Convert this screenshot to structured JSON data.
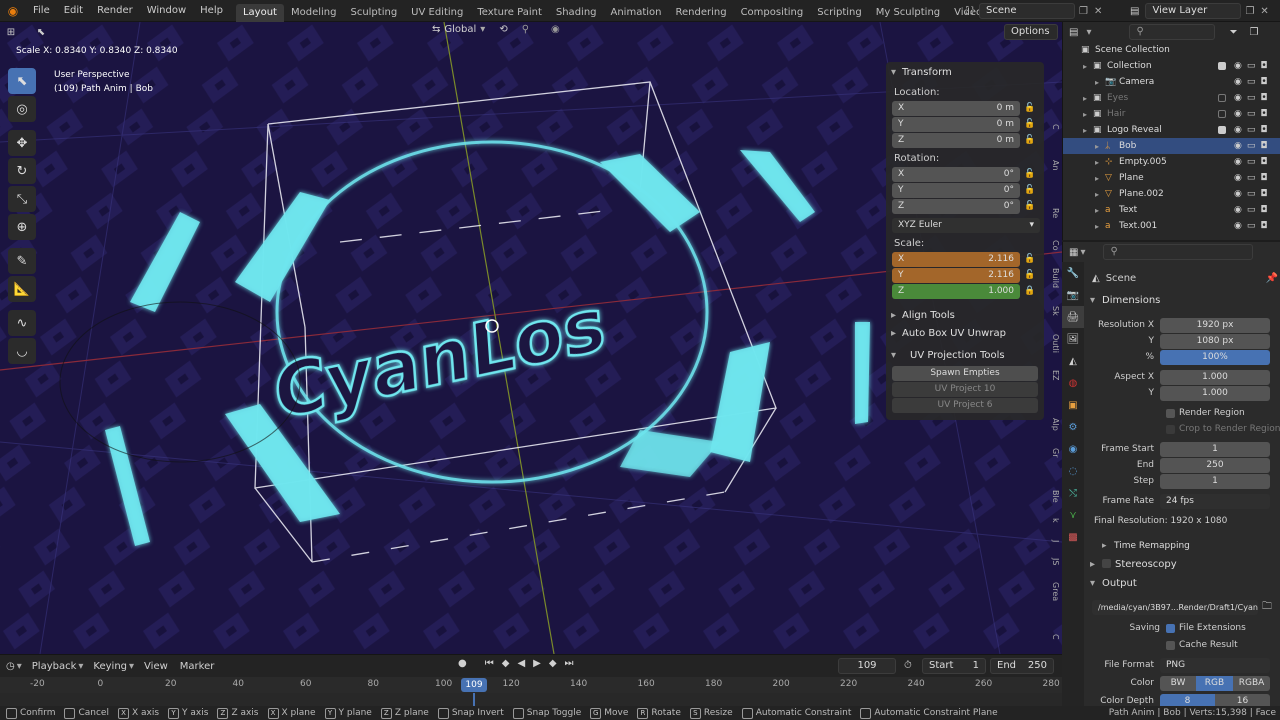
{
  "topbar": {
    "menus": [
      "File",
      "Edit",
      "Render",
      "Window",
      "Help"
    ],
    "workspaces": [
      "Layout",
      "Modeling",
      "Sculpting",
      "UV Editing",
      "Texture Paint",
      "Shading",
      "Animation",
      "Rendering",
      "Compositing",
      "Scripting",
      "My Sculpting",
      "Video Editing"
    ],
    "active_workspace": "Layout",
    "scene": "Scene",
    "view_layer": "View Layer"
  },
  "viewport": {
    "scale_readout": "Scale X: 0.8340   Y: 0.8340   Z: 0.8340",
    "orientation": "Global",
    "options_label": "Options",
    "view_name": "User Perspective",
    "object_info": "(109) Path Anim | Bob",
    "logo_text": "CyanLos"
  },
  "npanel": {
    "transform_title": "Transform",
    "location_label": "Location:",
    "location": [
      {
        "axis": "X",
        "value": "0 m"
      },
      {
        "axis": "Y",
        "value": "0 m"
      },
      {
        "axis": "Z",
        "value": "0 m"
      }
    ],
    "rotation_label": "Rotation:",
    "rotation": [
      {
        "axis": "X",
        "value": "0°"
      },
      {
        "axis": "Y",
        "value": "0°"
      },
      {
        "axis": "Z",
        "value": "0°"
      }
    ],
    "rotation_mode": "XYZ Euler",
    "scale_label": "Scale:",
    "scale": [
      {
        "axis": "X",
        "value": "2.116"
      },
      {
        "axis": "Y",
        "value": "2.116"
      },
      {
        "axis": "Z",
        "value": "1.000"
      }
    ],
    "align_tools": "Align Tools",
    "auto_box_uv": "Auto Box UV Unwrap",
    "uv_projection_tools": "UV Projection Tools",
    "spawn_empties": "Spawn Empties",
    "uv_project_10": "UV Project 10",
    "uv_project_6": "UV Project 6",
    "tabs": [
      "C",
      "An",
      "Re",
      "Co",
      "Build",
      "Sk",
      "Outli",
      "EZ",
      "Alp",
      "Gr",
      "Ble",
      "k",
      "J",
      "JS",
      "Grea",
      "C"
    ]
  },
  "outliner": {
    "rows": [
      {
        "label": "Scene Collection",
        "indent": 0,
        "sel": false,
        "dim": false,
        "check": null
      },
      {
        "label": "Collection",
        "indent": 1,
        "sel": false,
        "dim": false,
        "check": "on"
      },
      {
        "label": "Camera",
        "indent": 2,
        "sel": false,
        "dim": false,
        "check": null
      },
      {
        "label": "Eyes",
        "indent": 1,
        "sel": false,
        "dim": true,
        "check": "off"
      },
      {
        "label": "Hair",
        "indent": 1,
        "sel": false,
        "dim": true,
        "check": "off"
      },
      {
        "label": "Logo Reveal",
        "indent": 1,
        "sel": false,
        "dim": false,
        "check": "on"
      },
      {
        "label": "Bob",
        "indent": 2,
        "sel": true,
        "dim": false,
        "check": null
      },
      {
        "label": "Empty.005",
        "indent": 2,
        "sel": false,
        "dim": false,
        "check": null
      },
      {
        "label": "Plane",
        "indent": 2,
        "sel": false,
        "dim": false,
        "check": null
      },
      {
        "label": "Plane.002",
        "indent": 2,
        "sel": false,
        "dim": false,
        "check": null
      },
      {
        "label": "Text",
        "indent": 2,
        "sel": false,
        "dim": false,
        "check": null
      },
      {
        "label": "Text.001",
        "indent": 2,
        "sel": false,
        "dim": false,
        "check": null
      }
    ]
  },
  "properties": {
    "context": "Scene",
    "dimensions": "Dimensions",
    "res_x_label": "Resolution X",
    "res_x": "1920 px",
    "res_y_label": "Y",
    "res_y": "1080 px",
    "res_pct_label": "%",
    "res_pct": "100%",
    "aspect_x_label": "Aspect X",
    "aspect_x": "1.000",
    "aspect_y_label": "Y",
    "aspect_y": "1.000",
    "render_region": "Render Region",
    "crop_region": "Crop to Render Region",
    "frame_start_label": "Frame Start",
    "frame_start": "1",
    "frame_end_label": "End",
    "frame_end": "250",
    "frame_step_label": "Step",
    "frame_step": "1",
    "frame_rate_label": "Frame Rate",
    "frame_rate": "24 fps",
    "final_res": "Final Resolution: 1920 x 1080",
    "time_remapping": "Time Remapping",
    "stereoscopy": "Stereoscopy",
    "output": "Output",
    "output_path": "/media/cyan/3B97...Render/Draft1/Cyan",
    "saving_label": "Saving",
    "file_extensions": "File Extensions",
    "cache_result": "Cache Result",
    "file_format_label": "File Format",
    "file_format": "PNG",
    "color_label": "Color",
    "color_bw": "BW",
    "color_rgb": "RGB",
    "color_rgba": "RGBA",
    "color_depth_label": "Color Depth",
    "depth_8": "8",
    "depth_16": "16"
  },
  "timeline": {
    "playback": "Playback",
    "keying": "Keying",
    "view": "View",
    "marker": "Marker",
    "current_frame": "109",
    "start_label": "Start",
    "start": "1",
    "end_label": "End",
    "end": "250",
    "ruler": [
      "-20",
      "0",
      "20",
      "40",
      "60",
      "80",
      "100",
      "120",
      "140",
      "160",
      "180",
      "200",
      "220",
      "240",
      "260",
      "280"
    ]
  },
  "statusbar": {
    "items": [
      "Confirm",
      "Cancel",
      "X axis",
      "Y axis",
      "Z axis",
      "X plane",
      "Y plane",
      "Z plane",
      "Snap Invert",
      "Snap Toggle",
      "Move",
      "Rotate",
      "Resize",
      "Automatic Constraint",
      "Automatic Constraint Plane"
    ],
    "keys": [
      "",
      "",
      "X",
      "Y",
      "Z",
      "X",
      "Y",
      "Z",
      "",
      "",
      "G",
      "R",
      "S",
      "",
      ""
    ],
    "info": "Path Anim | Bob | Verts:15,398 | Face"
  },
  "colors": {
    "accent": "#4772b3",
    "cyan": "#6fe6ee",
    "viewport_bg": "#1c1740",
    "scale_x": "#a3662a",
    "scale_z": "#4a8a3a"
  }
}
